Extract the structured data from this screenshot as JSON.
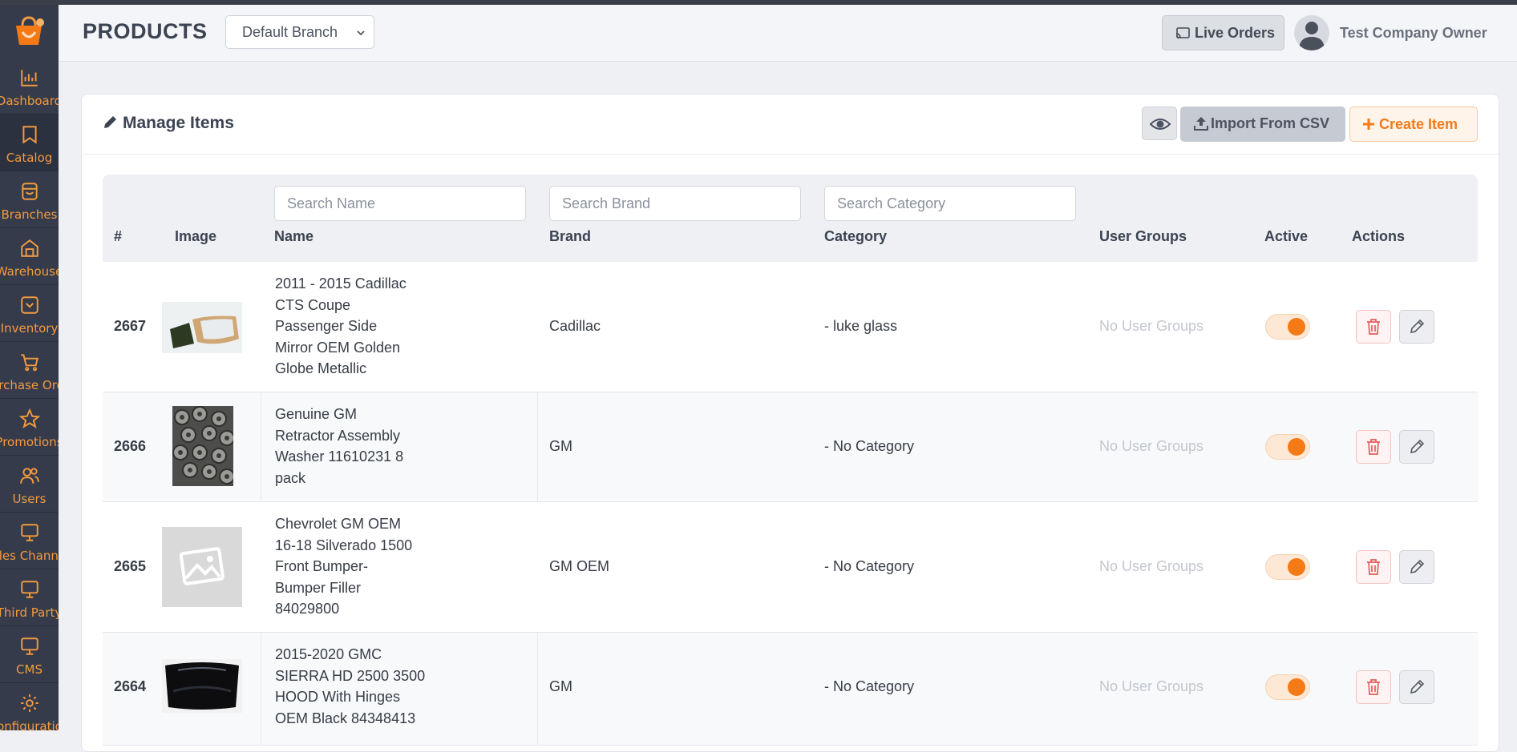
{
  "header": {
    "title": "PRODUCTS",
    "branch_selected": "Default Branch",
    "live_orders_label": "Live Orders",
    "user_name": "Test Company Owner"
  },
  "sidebar": {
    "items": [
      {
        "label": "Dashboard",
        "icon": "chart-icon"
      },
      {
        "label": "Catalog",
        "icon": "bookmark-icon"
      },
      {
        "label": "Branches",
        "icon": "store-icon"
      },
      {
        "label": "Warehouse",
        "icon": "warehouse-icon"
      },
      {
        "label": "Inventory",
        "icon": "inventory-icon"
      },
      {
        "label": "Purchase Orders",
        "icon": "cart-icon"
      },
      {
        "label": "Promotions",
        "icon": "star-icon"
      },
      {
        "label": "Users",
        "icon": "users-icon"
      },
      {
        "label": "Sales Channels",
        "icon": "monitor-icon"
      },
      {
        "label": "Third Party",
        "icon": "monitor-icon"
      },
      {
        "label": "CMS",
        "icon": "monitor-icon"
      },
      {
        "label": "Configuration",
        "icon": "gear-icon"
      }
    ]
  },
  "card": {
    "title": "Manage Items",
    "import_label": "Import From CSV",
    "create_label": "Create Item"
  },
  "table": {
    "search_name_placeholder": "Search Name",
    "search_brand_placeholder": "Search Brand",
    "search_category_placeholder": "Search Category",
    "columns": {
      "id": "#",
      "image": "Image",
      "name": "Name",
      "brand": "Brand",
      "category": "Category",
      "user_groups": "User Groups",
      "active": "Active",
      "actions": "Actions"
    },
    "rows": [
      {
        "id": "2667",
        "name_lines": [
          "2011 - 2015 Cadillac",
          "CTS Coupe",
          "Passenger Side",
          "Mirror OEM Golden",
          "Globe Metallic"
        ],
        "brand": "Cadillac",
        "category": "- luke glass",
        "user_groups": "No User Groups",
        "active": true
      },
      {
        "id": "2666",
        "name_lines": [
          "Genuine GM",
          "Retractor Assembly",
          "Washer 11610231 8",
          "pack"
        ],
        "brand": "GM",
        "category": "- No Category",
        "user_groups": "No User Groups",
        "active": true
      },
      {
        "id": "2665",
        "name_lines": [
          "Chevrolet GM OEM",
          "16-18 Silverado 1500",
          "Front Bumper-",
          "Bumper Filler",
          "84029800"
        ],
        "brand": "GM OEM",
        "category": "- No Category",
        "user_groups": "No User Groups",
        "active": true
      },
      {
        "id": "2664",
        "name_lines": [
          "2015-2020 GMC",
          "SIERRA HD 2500 3500",
          "HOOD With Hinges",
          "OEM Black 84348413"
        ],
        "brand": "GM",
        "category": "- No Category",
        "user_groups": "No User Groups",
        "active": true
      }
    ]
  },
  "colors": {
    "accent": "#f47a15",
    "sidebar_bg": "#353b4b",
    "danger": "#e06060"
  }
}
